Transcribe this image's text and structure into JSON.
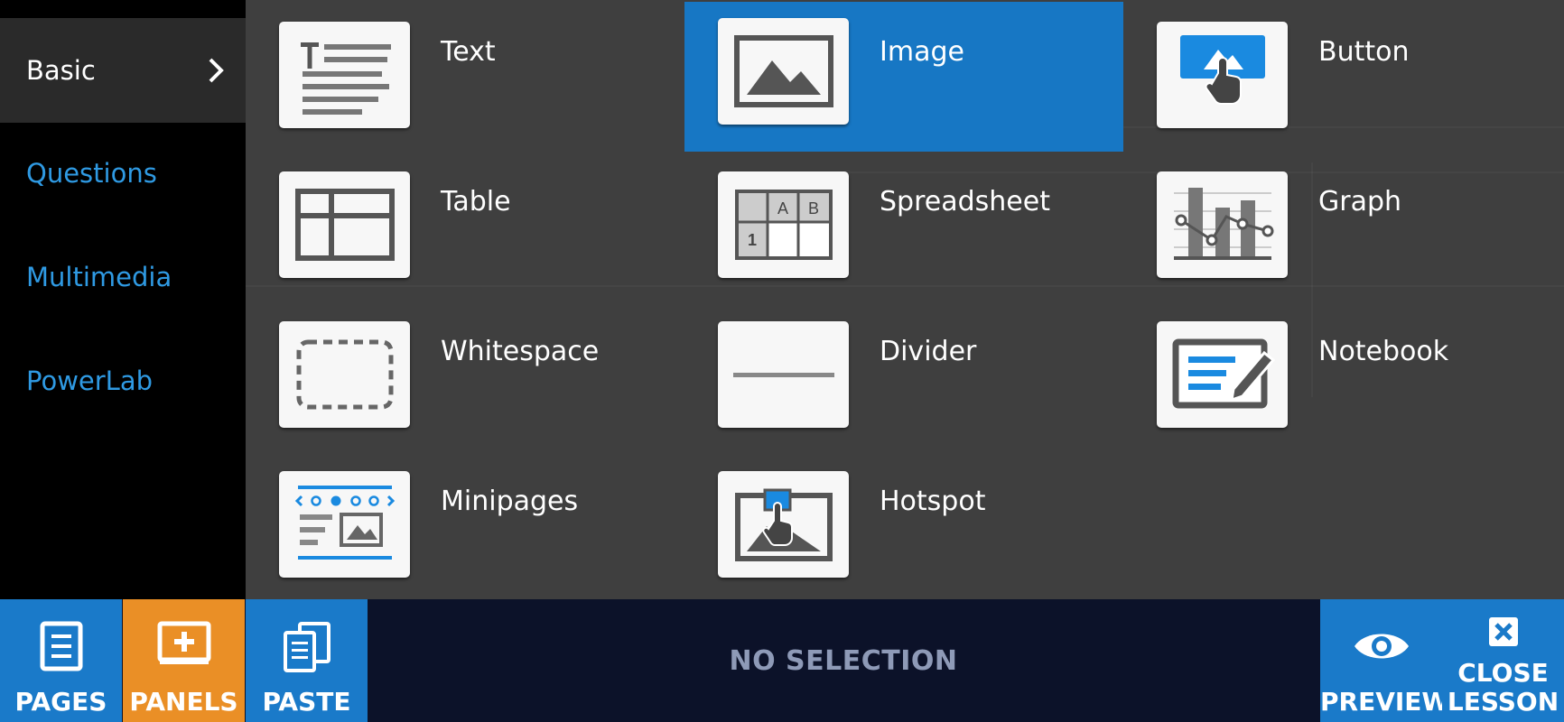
{
  "sidebar": {
    "items": [
      {
        "label": "Basic",
        "active": true
      },
      {
        "label": "Questions",
        "active": false
      },
      {
        "label": "Multimedia",
        "active": false
      },
      {
        "label": "PowerLab",
        "active": false
      }
    ]
  },
  "panels": [
    {
      "label": "Text",
      "icon": "text-icon",
      "selected": false
    },
    {
      "label": "Image",
      "icon": "image-icon",
      "selected": true
    },
    {
      "label": "Button",
      "icon": "button-icon",
      "selected": false
    },
    {
      "label": "Table",
      "icon": "table-icon",
      "selected": false
    },
    {
      "label": "Spreadsheet",
      "icon": "spreadsheet-icon",
      "selected": false,
      "icon_text": {
        "col_a": "A",
        "col_b": "B",
        "row_1": "1"
      }
    },
    {
      "label": "Graph",
      "icon": "graph-icon",
      "selected": false
    },
    {
      "label": "Whitespace",
      "icon": "whitespace-icon",
      "selected": false
    },
    {
      "label": "Divider",
      "icon": "divider-icon",
      "selected": false
    },
    {
      "label": "Notebook",
      "icon": "notebook-icon",
      "selected": false
    },
    {
      "label": "Minipages",
      "icon": "minipages-icon",
      "selected": false
    },
    {
      "label": "Hotspot",
      "icon": "hotspot-icon",
      "selected": false
    }
  ],
  "bottombar": {
    "pages_label": "PAGES",
    "panels_label": "PANELS",
    "paste_label": "PASTE",
    "status": "NO SELECTION",
    "preview_label": "PREVIEW",
    "close_label_1": "CLOSE",
    "close_label_2": "LESSON"
  },
  "colors": {
    "accent_blue": "#1777c4",
    "link_blue": "#2f9ae3",
    "panels_orange": "#ea8f26",
    "bar_navy": "#0c1229"
  }
}
